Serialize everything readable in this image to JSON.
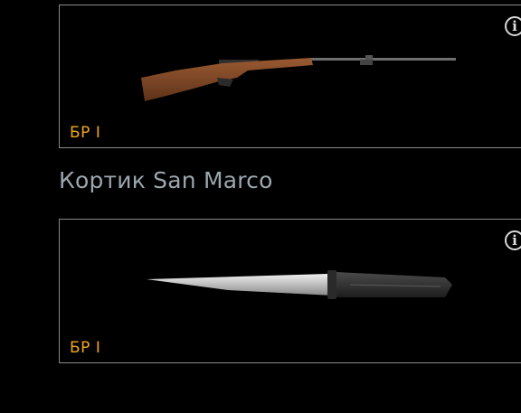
{
  "items": [
    {
      "icon": "rifle-icon",
      "badge": "БР I",
      "info_icon": "info-icon"
    },
    {
      "title": "Кортик San Marco",
      "icon": "knife-icon",
      "badge": "БР I",
      "info_icon": "info-icon"
    }
  ],
  "colors": {
    "background": "#000000",
    "badge": "#f0a81e",
    "title": "#9aa7ad",
    "border": "#8a8a8a"
  }
}
